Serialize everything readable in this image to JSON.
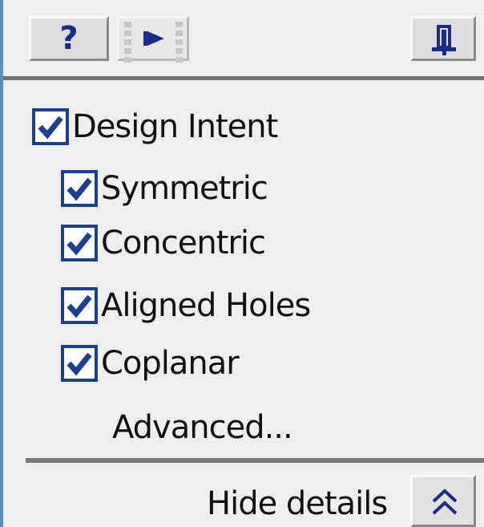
{
  "toolbar": {
    "help_label": "?",
    "play_icon": "play-icon",
    "pin_icon": "pin-icon"
  },
  "design_intent": {
    "label": "Design Intent",
    "checked": true,
    "items": [
      {
        "label": "Symmetric",
        "checked": true
      },
      {
        "label": "Concentric",
        "checked": true
      },
      {
        "label": "Aligned Holes",
        "checked": true
      },
      {
        "label": "Coplanar",
        "checked": true
      }
    ],
    "advanced_label": "Advanced..."
  },
  "footer": {
    "hide_details_label": "Hide details",
    "collapse_icon": "double-chevron-up-icon"
  },
  "colors": {
    "check": "#1d3f8f",
    "accent_border": "#5b8fc4",
    "text": "#111111"
  }
}
